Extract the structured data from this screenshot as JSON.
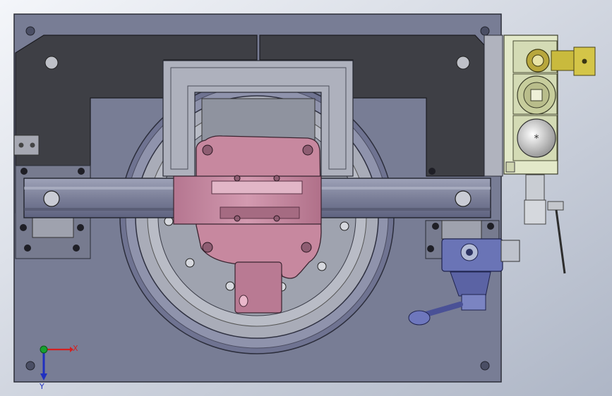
{
  "triad": {
    "x_label": "X",
    "y_label": "Y",
    "colors": {
      "x": "#d42020",
      "y": "#18a030",
      "z": "#2030c0"
    }
  },
  "palette": {
    "background_light": "#eef1f6",
    "background_dark": "#b4bccb",
    "base_plate": "#7a7f96",
    "dark_frame": "#3f4046",
    "turntable": "#a9acb8",
    "clamp_body": "#c88aa2",
    "valve_assembly": "#e6eccb",
    "valve_brass": "#c8ba3a",
    "blue_valve": "#6a74b6"
  },
  "components": [
    "base-plate",
    "frame",
    "turntable",
    "crossbar",
    "clamp",
    "valve-stack",
    "blue-valve"
  ]
}
